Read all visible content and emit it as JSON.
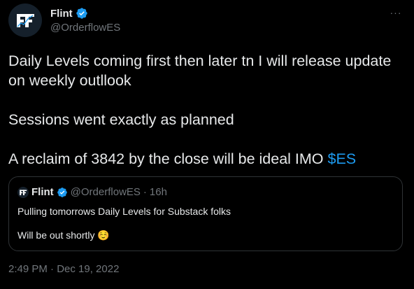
{
  "author": {
    "display_name": "Flint",
    "handle": "@OrderflowES",
    "verified": true,
    "avatar_icon": "flint-logo-icon"
  },
  "menu": {
    "more_label": "···"
  },
  "tweet": {
    "line1": "Daily Levels coming first then later tn I will release update on weekly outllook",
    "line2": "Sessions went exactly as planned",
    "line3_prefix": "A reclaim of 3842 by the close will be ideal IMO ",
    "cashtag": "$ES"
  },
  "quoted": {
    "display_name": "Flint",
    "handle": "@OrderflowES",
    "separator": "·",
    "age": "16h",
    "line1": "Pulling tomorrows Daily Levels for Substack folks",
    "line2": "Will be out shortly",
    "emoji": "☺️"
  },
  "timestamp": "2:49 PM · Dec 19, 2022",
  "colors": {
    "background": "#000000",
    "text": "#e7e9ea",
    "muted": "#71767b",
    "accent": "#1d9bf0",
    "border": "#2f3336"
  }
}
